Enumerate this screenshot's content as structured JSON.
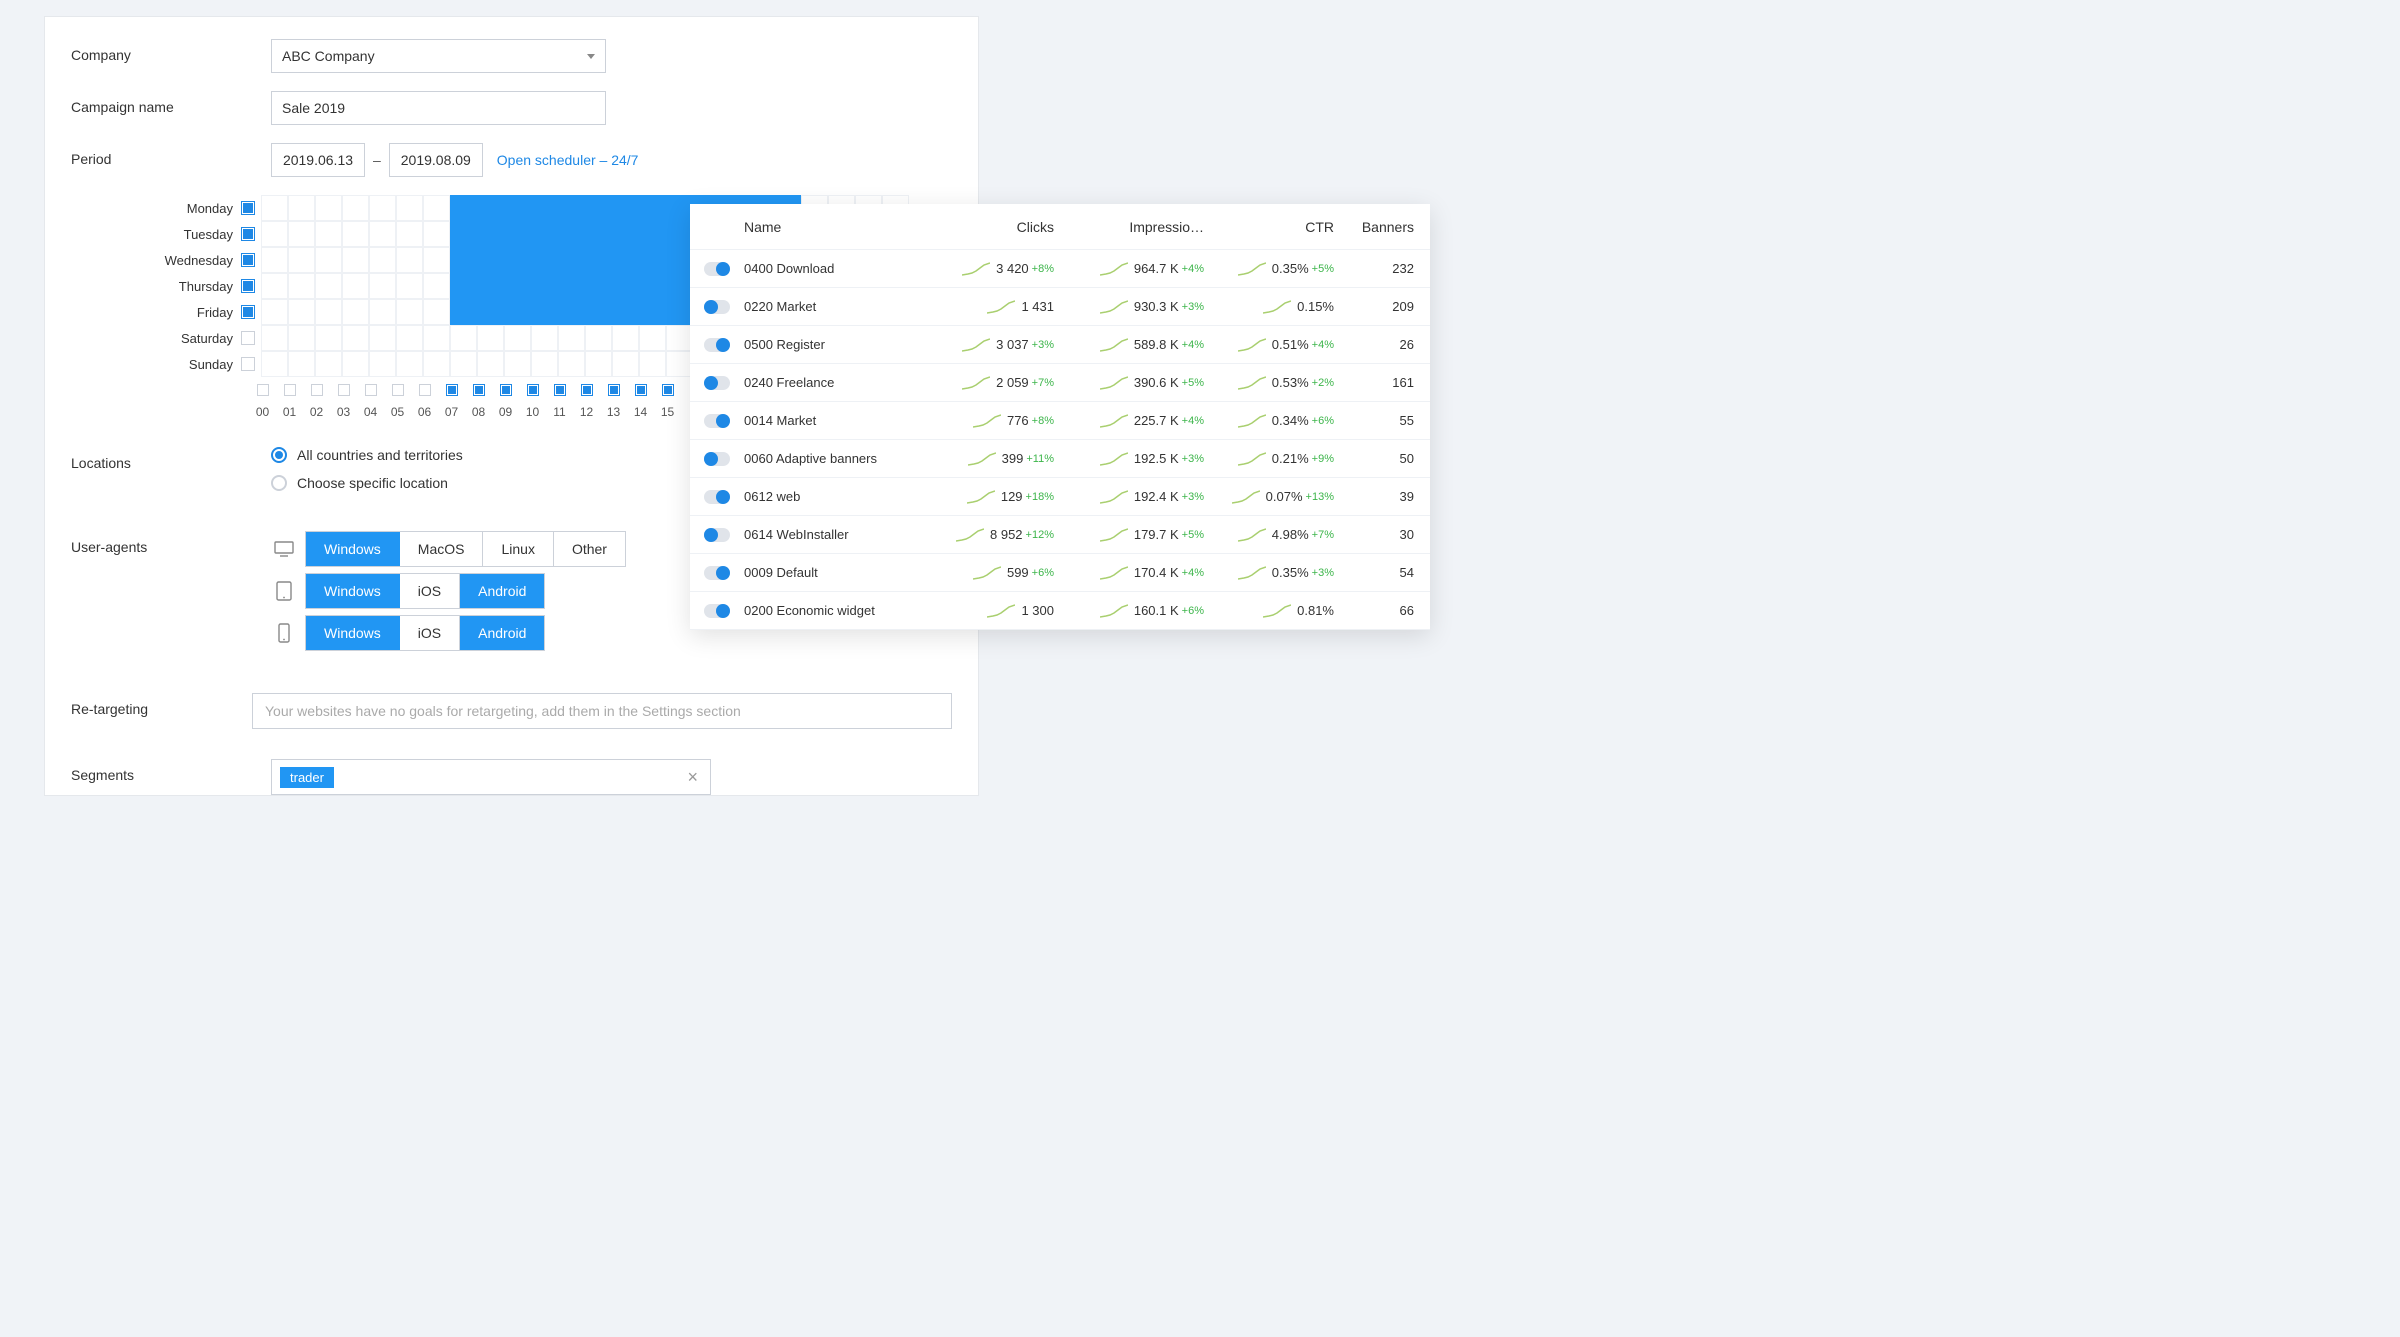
{
  "form": {
    "company_label": "Company",
    "company_value": "ABC Company",
    "campaign_label": "Campaign name",
    "campaign_value": "Sale 2019",
    "period_label": "Period",
    "period_from": "2019.06.13",
    "period_to": "2019.08.09",
    "scheduler_link": "Open scheduler – 24/7",
    "locations_label": "Locations",
    "locations_opt_all": "All countries and territories",
    "locations_opt_specific": "Choose specific location",
    "useragents_label": "User-agents",
    "retarget_label": "Re-targeting",
    "retarget_placeholder": "Your websites have no goals for retargeting, add them in the Settings section",
    "segments_label": "Segments",
    "segment_tag": "trader"
  },
  "schedule": {
    "days": [
      {
        "label": "Monday",
        "enabled": true
      },
      {
        "label": "Tuesday",
        "enabled": true
      },
      {
        "label": "Wednesday",
        "enabled": true
      },
      {
        "label": "Thursday",
        "enabled": true
      },
      {
        "label": "Friday",
        "enabled": true
      },
      {
        "label": "Saturday",
        "enabled": false
      },
      {
        "label": "Sunday",
        "enabled": false
      }
    ],
    "hours": [
      "00",
      "01",
      "02",
      "03",
      "04",
      "05",
      "06",
      "07",
      "08",
      "09",
      "10",
      "11",
      "12",
      "13",
      "14",
      "15"
    ],
    "hour_active_from_index": 7,
    "day_cells_visible": 24,
    "active_block": {
      "day_start": 0,
      "day_end": 4,
      "hour_start": 7,
      "hour_end": 19
    }
  },
  "useragents": {
    "desktop": [
      {
        "label": "Windows",
        "active": true
      },
      {
        "label": "MacOS",
        "active": false
      },
      {
        "label": "Linux",
        "active": false
      },
      {
        "label": "Other",
        "active": false
      }
    ],
    "tablet": [
      {
        "label": "Windows",
        "active": true
      },
      {
        "label": "iOS",
        "active": false
      },
      {
        "label": "Android",
        "active": true
      }
    ],
    "mobile": [
      {
        "label": "Windows",
        "active": true
      },
      {
        "label": "iOS",
        "active": false
      },
      {
        "label": "Android",
        "active": true
      }
    ]
  },
  "table": {
    "headers": {
      "name": "Name",
      "clicks": "Clicks",
      "impressions": "Impressio…",
      "ctr": "CTR",
      "banners": "Banners"
    },
    "rows": [
      {
        "on": true,
        "name": "0400 Download",
        "clicks": "3 420",
        "clicks_d": "+8%",
        "impr": "964.7 K",
        "impr_d": "+4%",
        "ctr": "0.35%",
        "ctr_d": "+5%",
        "banners": "232"
      },
      {
        "on": false,
        "name": "0220 Market",
        "clicks": "1 431",
        "clicks_d": "",
        "impr": "930.3 K",
        "impr_d": "+3%",
        "ctr": "0.15%",
        "ctr_d": "",
        "banners": "209"
      },
      {
        "on": true,
        "name": "0500 Register",
        "clicks": "3 037",
        "clicks_d": "+3%",
        "impr": "589.8 K",
        "impr_d": "+4%",
        "ctr": "0.51%",
        "ctr_d": "+4%",
        "banners": "26"
      },
      {
        "on": false,
        "name": "0240 Freelance",
        "clicks": "2 059",
        "clicks_d": "+7%",
        "impr": "390.6 K",
        "impr_d": "+5%",
        "ctr": "0.53%",
        "ctr_d": "+2%",
        "banners": "161"
      },
      {
        "on": true,
        "name": "0014 Market",
        "clicks": "776",
        "clicks_d": "+8%",
        "impr": "225.7 K",
        "impr_d": "+4%",
        "ctr": "0.34%",
        "ctr_d": "+6%",
        "banners": "55"
      },
      {
        "on": false,
        "name": "0060 Adaptive banners",
        "clicks": "399",
        "clicks_d": "+11%",
        "impr": "192.5 K",
        "impr_d": "+3%",
        "ctr": "0.21%",
        "ctr_d": "+9%",
        "banners": "50"
      },
      {
        "on": true,
        "name": "0612 web",
        "clicks": "129",
        "clicks_d": "+18%",
        "impr": "192.4 K",
        "impr_d": "+3%",
        "ctr": "0.07%",
        "ctr_d": "+13%",
        "banners": "39"
      },
      {
        "on": false,
        "name": "0614 WebInstaller",
        "clicks": "8 952",
        "clicks_d": "+12%",
        "impr": "179.7 K",
        "impr_d": "+5%",
        "ctr": "4.98%",
        "ctr_d": "+7%",
        "banners": "30"
      },
      {
        "on": true,
        "name": "0009 Default",
        "clicks": "599",
        "clicks_d": "+6%",
        "impr": "170.4 K",
        "impr_d": "+4%",
        "ctr": "0.35%",
        "ctr_d": "+3%",
        "banners": "54"
      },
      {
        "on": true,
        "name": "0200 Economic widget",
        "clicks": "1 300",
        "clicks_d": "",
        "impr": "160.1 K",
        "impr_d": "+6%",
        "ctr": "0.81%",
        "ctr_d": "",
        "banners": "66"
      }
    ]
  }
}
